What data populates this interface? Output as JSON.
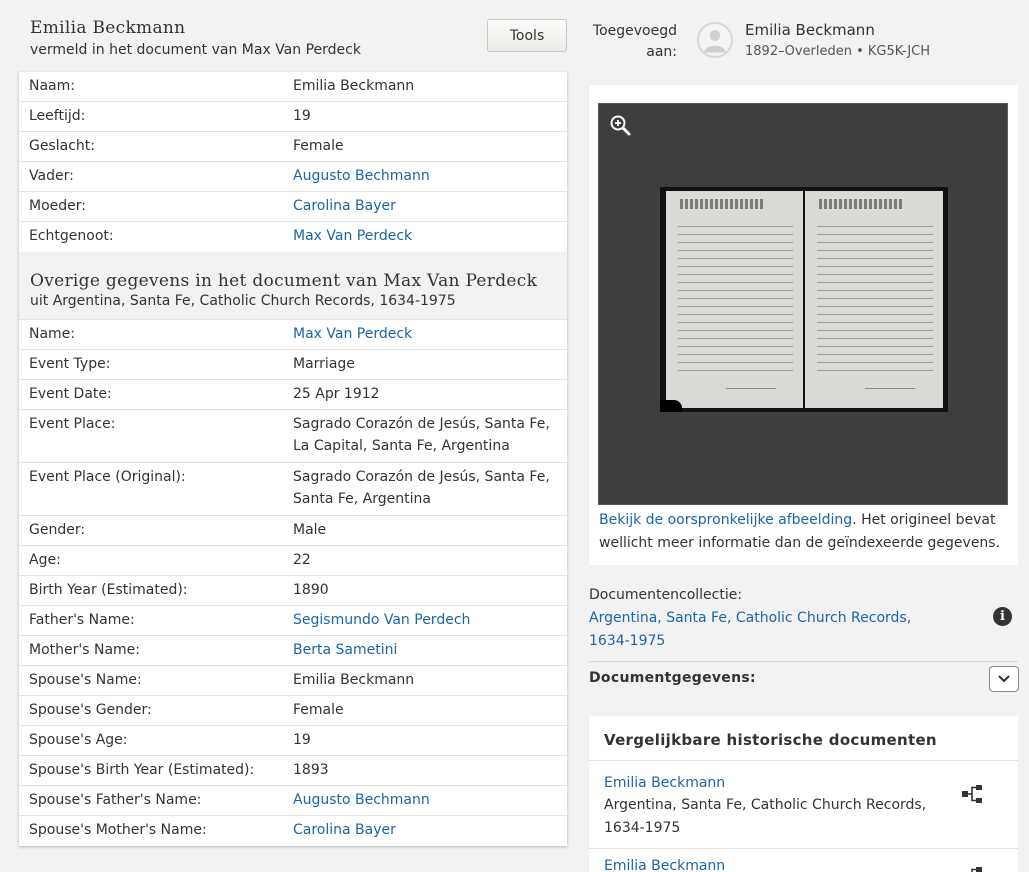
{
  "person": {
    "name": "Emilia Beckmann",
    "subtitle": "vermeld in het document van Max Van Perdeck",
    "tools_label": "Tools"
  },
  "person_details": [
    {
      "label": "Naam:",
      "value": "Emilia Beckmann",
      "link": false
    },
    {
      "label": "Leeftijd:",
      "value": "19",
      "link": false
    },
    {
      "label": "Geslacht:",
      "value": "Female",
      "link": false
    },
    {
      "label": "Vader:",
      "value": "Augusto Bechmann",
      "link": true
    },
    {
      "label": "Moeder:",
      "value": "Carolina Bayer",
      "link": true
    },
    {
      "label": "Echtgenoot:",
      "value": "Max Van Perdeck",
      "link": true
    }
  ],
  "other_section": {
    "title": "Overige gegevens in het document van Max Van Perdeck",
    "subtitle": "uit Argentina, Santa Fe, Catholic Church Records, 1634-1975"
  },
  "other_details": [
    {
      "label": "Name:",
      "value": "Max Van Perdeck",
      "link": true
    },
    {
      "label": "Event Type:",
      "value": "Marriage",
      "link": false
    },
    {
      "label": "Event Date:",
      "value": "25 Apr 1912",
      "link": false
    },
    {
      "label": "Event Place:",
      "value": "Sagrado Corazón de Jesús, Santa Fe, La Capital, Santa Fe, Argentina",
      "link": false,
      "tall": true
    },
    {
      "label": "Event Place (Original):",
      "value": "Sagrado Corazón de Jesús, Santa Fe, Santa Fe, Argentina",
      "link": false,
      "tall": true
    },
    {
      "label": "Gender:",
      "value": "Male",
      "link": false
    },
    {
      "label": "Age:",
      "value": "22",
      "link": false
    },
    {
      "label": "Birth Year (Estimated):",
      "value": "1890",
      "link": false
    },
    {
      "label": "Father's Name:",
      "value": "Segismundo Van Perdech",
      "link": true
    },
    {
      "label": "Mother's Name:",
      "value": "Berta Sametini",
      "link": true
    },
    {
      "label": "Spouse's Name:",
      "value": "Emilia Beckmann",
      "link": false
    },
    {
      "label": "Spouse's Gender:",
      "value": "Female",
      "link": false
    },
    {
      "label": "Spouse's Age:",
      "value": "19",
      "link": false
    },
    {
      "label": "Spouse's Birth Year (Estimated):",
      "value": "1893",
      "link": false
    },
    {
      "label": "Spouse's Father's Name:",
      "value": "Augusto Bechmann",
      "link": true
    },
    {
      "label": "Spouse's Mother's Name:",
      "value": "Carolina Bayer",
      "link": true
    }
  ],
  "attached": {
    "label": "Toegevoegd aan:",
    "name": "Emilia Beckmann",
    "meta": "1892–Overleden • KG5K-JCH"
  },
  "image_card": {
    "link_text": "Bekijk de oorspronkelijke afbeelding",
    "caption_rest": ". Het origineel bevat wellicht meer informatie dan de geïndexeerde gegevens."
  },
  "collection": {
    "label": "Documentencollectie:",
    "link": "Argentina, Santa Fe, Catholic Church Records, 1634-1975"
  },
  "document_data": {
    "label": "Documentgegevens:"
  },
  "similar": {
    "title": "Vergelijkbare historische documenten",
    "items": [
      {
        "name": "Emilia Beckmann",
        "sub": "Argentina, Santa Fe, Catholic Church Records, 1634-1975"
      },
      {
        "name": "Emilia Beckmann",
        "sub": ""
      }
    ]
  },
  "icons": {
    "zoom": "zoom-in-icon",
    "avatar": "person-silhouette-icon",
    "info": "info-icon",
    "chevron": "chevron-down-icon",
    "tree": "family-tree-icon"
  },
  "colors": {
    "link": "#1a65a8",
    "page_bg": "#f2f2f2",
    "viewer_bg": "#3e3e3e"
  }
}
